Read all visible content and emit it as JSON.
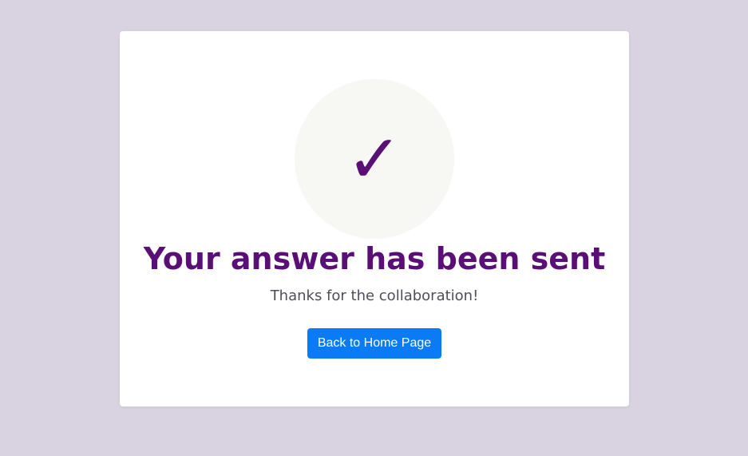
{
  "icon": {
    "name": "checkmark-icon",
    "glyph": "✓",
    "color": "#590f76",
    "circle_color": "#f7f8f4"
  },
  "confirmation": {
    "title": "Your answer has been sent",
    "subtitle": "Thanks for the collaboration!"
  },
  "actions": {
    "home_button_label": "Back to Home Page",
    "home_button_color": "#0a7bf4"
  },
  "colors": {
    "background": "#d9d2e0",
    "card": "#ffffff",
    "title": "#590f76",
    "subtitle": "#4e4e5a"
  }
}
